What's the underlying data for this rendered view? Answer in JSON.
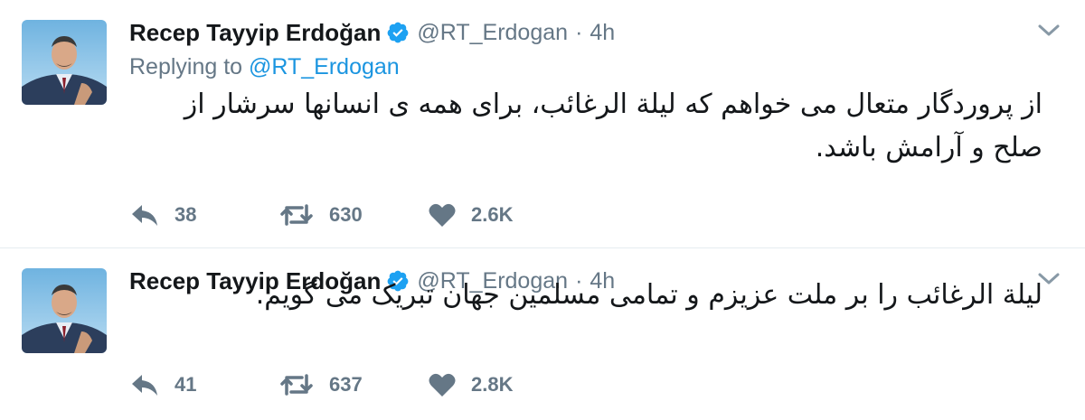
{
  "tweets": [
    {
      "author_name": "Recep Tayyip Erdoğan",
      "handle": "@RT_Erdogan",
      "separator": "·",
      "time": "4h",
      "replying_to_label": "Replying to",
      "replying_to_handle": "@RT_Erdogan",
      "text": "از پروردگار متعال می خواهم که لیلة الرغائب، برای همه ی انسانها سرشار از صلح و آرامش باشد.",
      "replies": "38",
      "retweets": "630",
      "likes": "2.6K"
    },
    {
      "author_name": "Recep Tayyip Erdoğan",
      "handle": "@RT_Erdogan",
      "separator": "·",
      "time": "4h",
      "text": "لیلة الرغائب را بر ملت عزیزم و تمامی مسلمین جهان تبریک می گویم.",
      "replies": "41",
      "retweets": "637",
      "likes": "2.8K"
    }
  ],
  "icons": {
    "verified": "verified-badge-icon",
    "menu": "chevron-down-icon",
    "reply": "reply-icon",
    "retweet": "retweet-icon",
    "like": "heart-icon"
  },
  "colors": {
    "primary_text": "#14171a",
    "secondary_text": "#657786",
    "link": "#1b95e0",
    "verified": "#1da1f2",
    "divider": "#e6ecf0",
    "icon": "#657786"
  }
}
